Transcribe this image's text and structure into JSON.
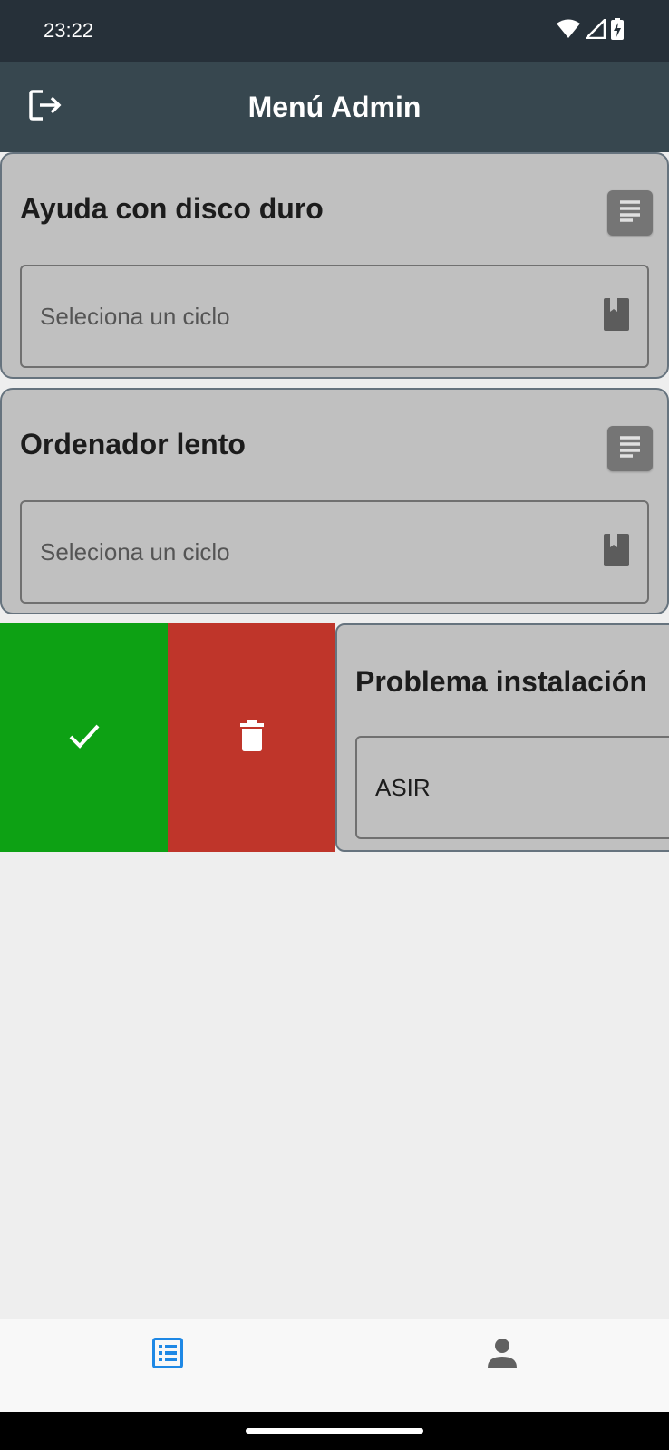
{
  "status_bar": {
    "time": "23:22",
    "icons": [
      "wifi-icon",
      "signal-icon",
      "battery-charging-icon"
    ]
  },
  "app_bar": {
    "title": "Menú Admin",
    "leading_icon": "logout-icon"
  },
  "tickets": [
    {
      "title": "Ayuda con disco duro",
      "cycle_placeholder": "Seleciona un ciclo",
      "cycle_value": "",
      "action_icon": "document-icon",
      "field_icon": "book-icon"
    },
    {
      "title": "Ordenador lento",
      "cycle_placeholder": "Seleciona un ciclo",
      "cycle_value": "",
      "action_icon": "document-icon",
      "field_icon": "book-icon"
    },
    {
      "title": "Problema instalación",
      "cycle_placeholder": "",
      "cycle_value": "ASIR",
      "swiped": true
    }
  ],
  "swipe_actions": [
    {
      "name": "accept",
      "icon": "check-icon",
      "color": "#0da114"
    },
    {
      "name": "delete",
      "icon": "trash-icon",
      "color": "#bf352a"
    }
  ],
  "bottom_nav": {
    "items": [
      {
        "icon": "list-icon",
        "active": true,
        "color": "#1e88e5"
      },
      {
        "icon": "person-icon",
        "active": false,
        "color": "#616161"
      }
    ]
  },
  "colors": {
    "status_bar": "#263039",
    "app_bar": "#37474f",
    "card": "#c0c0c0",
    "card_border": "#66737e",
    "background": "#eeeeee"
  }
}
